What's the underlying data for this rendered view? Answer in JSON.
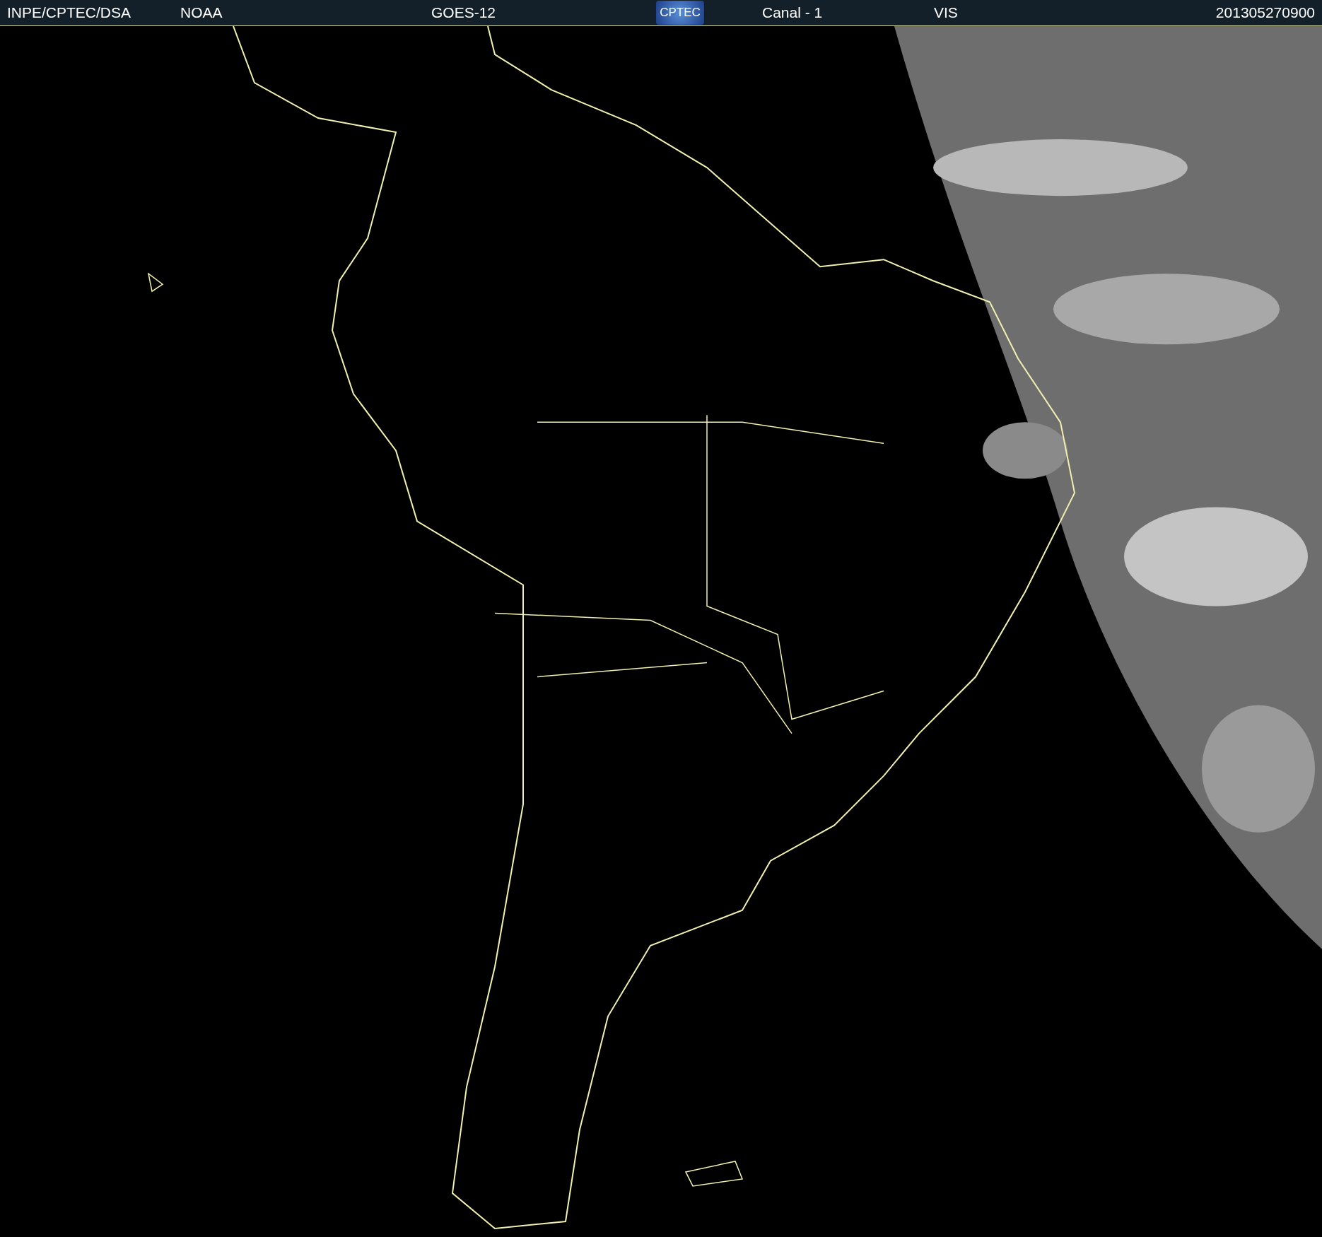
{
  "header": {
    "items": [
      {
        "kind": "text",
        "text": "INPE/CPTEC/DSA"
      },
      {
        "kind": "text",
        "text": "NOAA"
      },
      {
        "kind": "text",
        "text": "GOES-12"
      },
      {
        "kind": "logo",
        "text": "CPTEC"
      },
      {
        "kind": "text",
        "text": "Canal - 1"
      },
      {
        "kind": "text",
        "text": "VIS"
      },
      {
        "kind": "text",
        "text": "201305270900"
      }
    ]
  }
}
